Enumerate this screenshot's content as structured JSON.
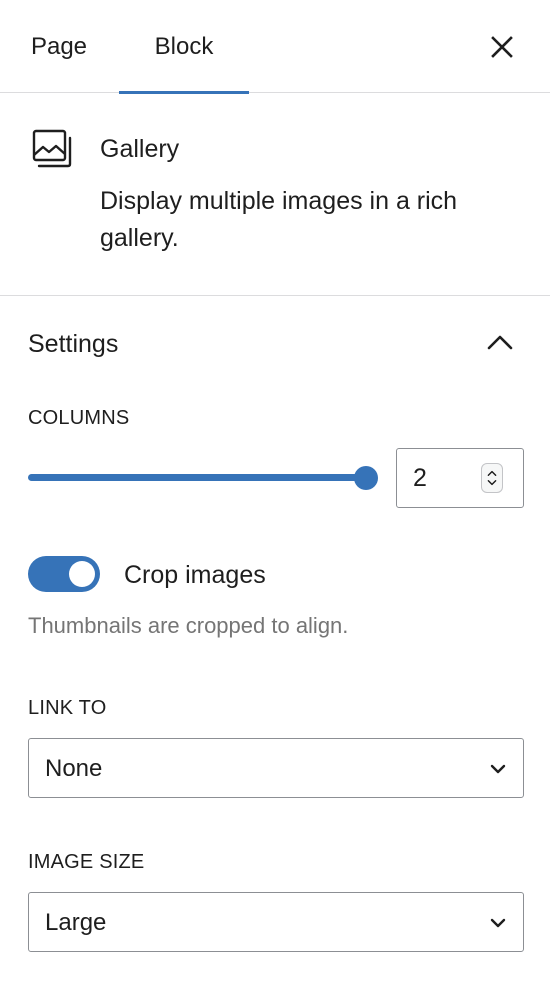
{
  "tabs": {
    "page_label": "Page",
    "block_label": "Block",
    "active": "Block"
  },
  "close_icon": "close-icon",
  "block_card": {
    "icon": "gallery-icon",
    "title": "Gallery",
    "description": "Display multiple images in a rich gallery."
  },
  "settings": {
    "title": "Settings",
    "expanded": true,
    "columns": {
      "label": "COLUMNS",
      "value": "2",
      "slider_fraction": 1.0
    },
    "crop": {
      "label": "Crop images",
      "enabled": true,
      "help": "Thumbnails are cropped to align."
    },
    "link_to": {
      "label": "LINK TO",
      "value": "None"
    },
    "image_size": {
      "label": "IMAGE SIZE",
      "value": "Large"
    }
  },
  "colors": {
    "accent": "#3673b8",
    "text": "#1e1e1e",
    "muted": "#757575",
    "border": "#8c8f94"
  }
}
